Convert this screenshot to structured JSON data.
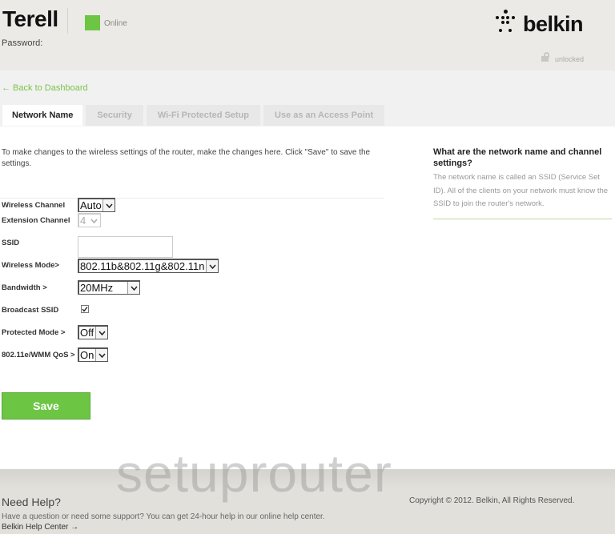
{
  "header": {
    "router_name": "Terell",
    "status": "Online",
    "status_color": "#6cc644",
    "password_label": "Password:",
    "brand": "belkin",
    "lock_icon": "unlocked-padlock-icon",
    "lock_status": "unlocked"
  },
  "nav": {
    "back_link": "← Back to Dashboard",
    "tabs": [
      {
        "label": "Network Name",
        "active": true
      },
      {
        "label": "Security",
        "active": false
      },
      {
        "label": "Wi-Fi Protected Setup",
        "active": false
      },
      {
        "label": "Use as an Access Point",
        "active": false
      }
    ]
  },
  "main": {
    "intro": "To make changes to the wireless settings of the router, make the changes here. Click \"Save\" to save the settings.",
    "fields": {
      "wireless_channel": {
        "label": "Wireless Channel",
        "value": "Auto"
      },
      "extension_channel": {
        "label": "Extension Channel",
        "value": "4",
        "disabled": true
      },
      "ssid": {
        "label": "SSID",
        "value": ""
      },
      "wireless_mode": {
        "label": "Wireless Mode>",
        "value": "802.11b&802.11g&802.11n"
      },
      "bandwidth": {
        "label": "Bandwidth >",
        "value": "20MHz"
      },
      "broadcast_ssid": {
        "label": "Broadcast SSID",
        "checked": true
      },
      "protected_mode": {
        "label": "Protected Mode >",
        "value": "Off"
      },
      "wmm_qos": {
        "label": "802.11e/WMM QoS >",
        "value": "On"
      }
    },
    "save_label": "Save",
    "accent": "#6cc644"
  },
  "help_panel": {
    "title": "What are the network name and channel settings?",
    "body": "The network name is called an SSID (Service Set ID). All of the clients on your network must know the SSID to join the router's network."
  },
  "footer": {
    "watermark": "setuprouter",
    "need_help": "Need Help?",
    "description": "Have a question or need some support? You can get 24-hour help in our online help center.",
    "help_link": "Belkin Help Center →",
    "copyright": "Copyright © 2012. Belkin, All Rights Reserved."
  }
}
